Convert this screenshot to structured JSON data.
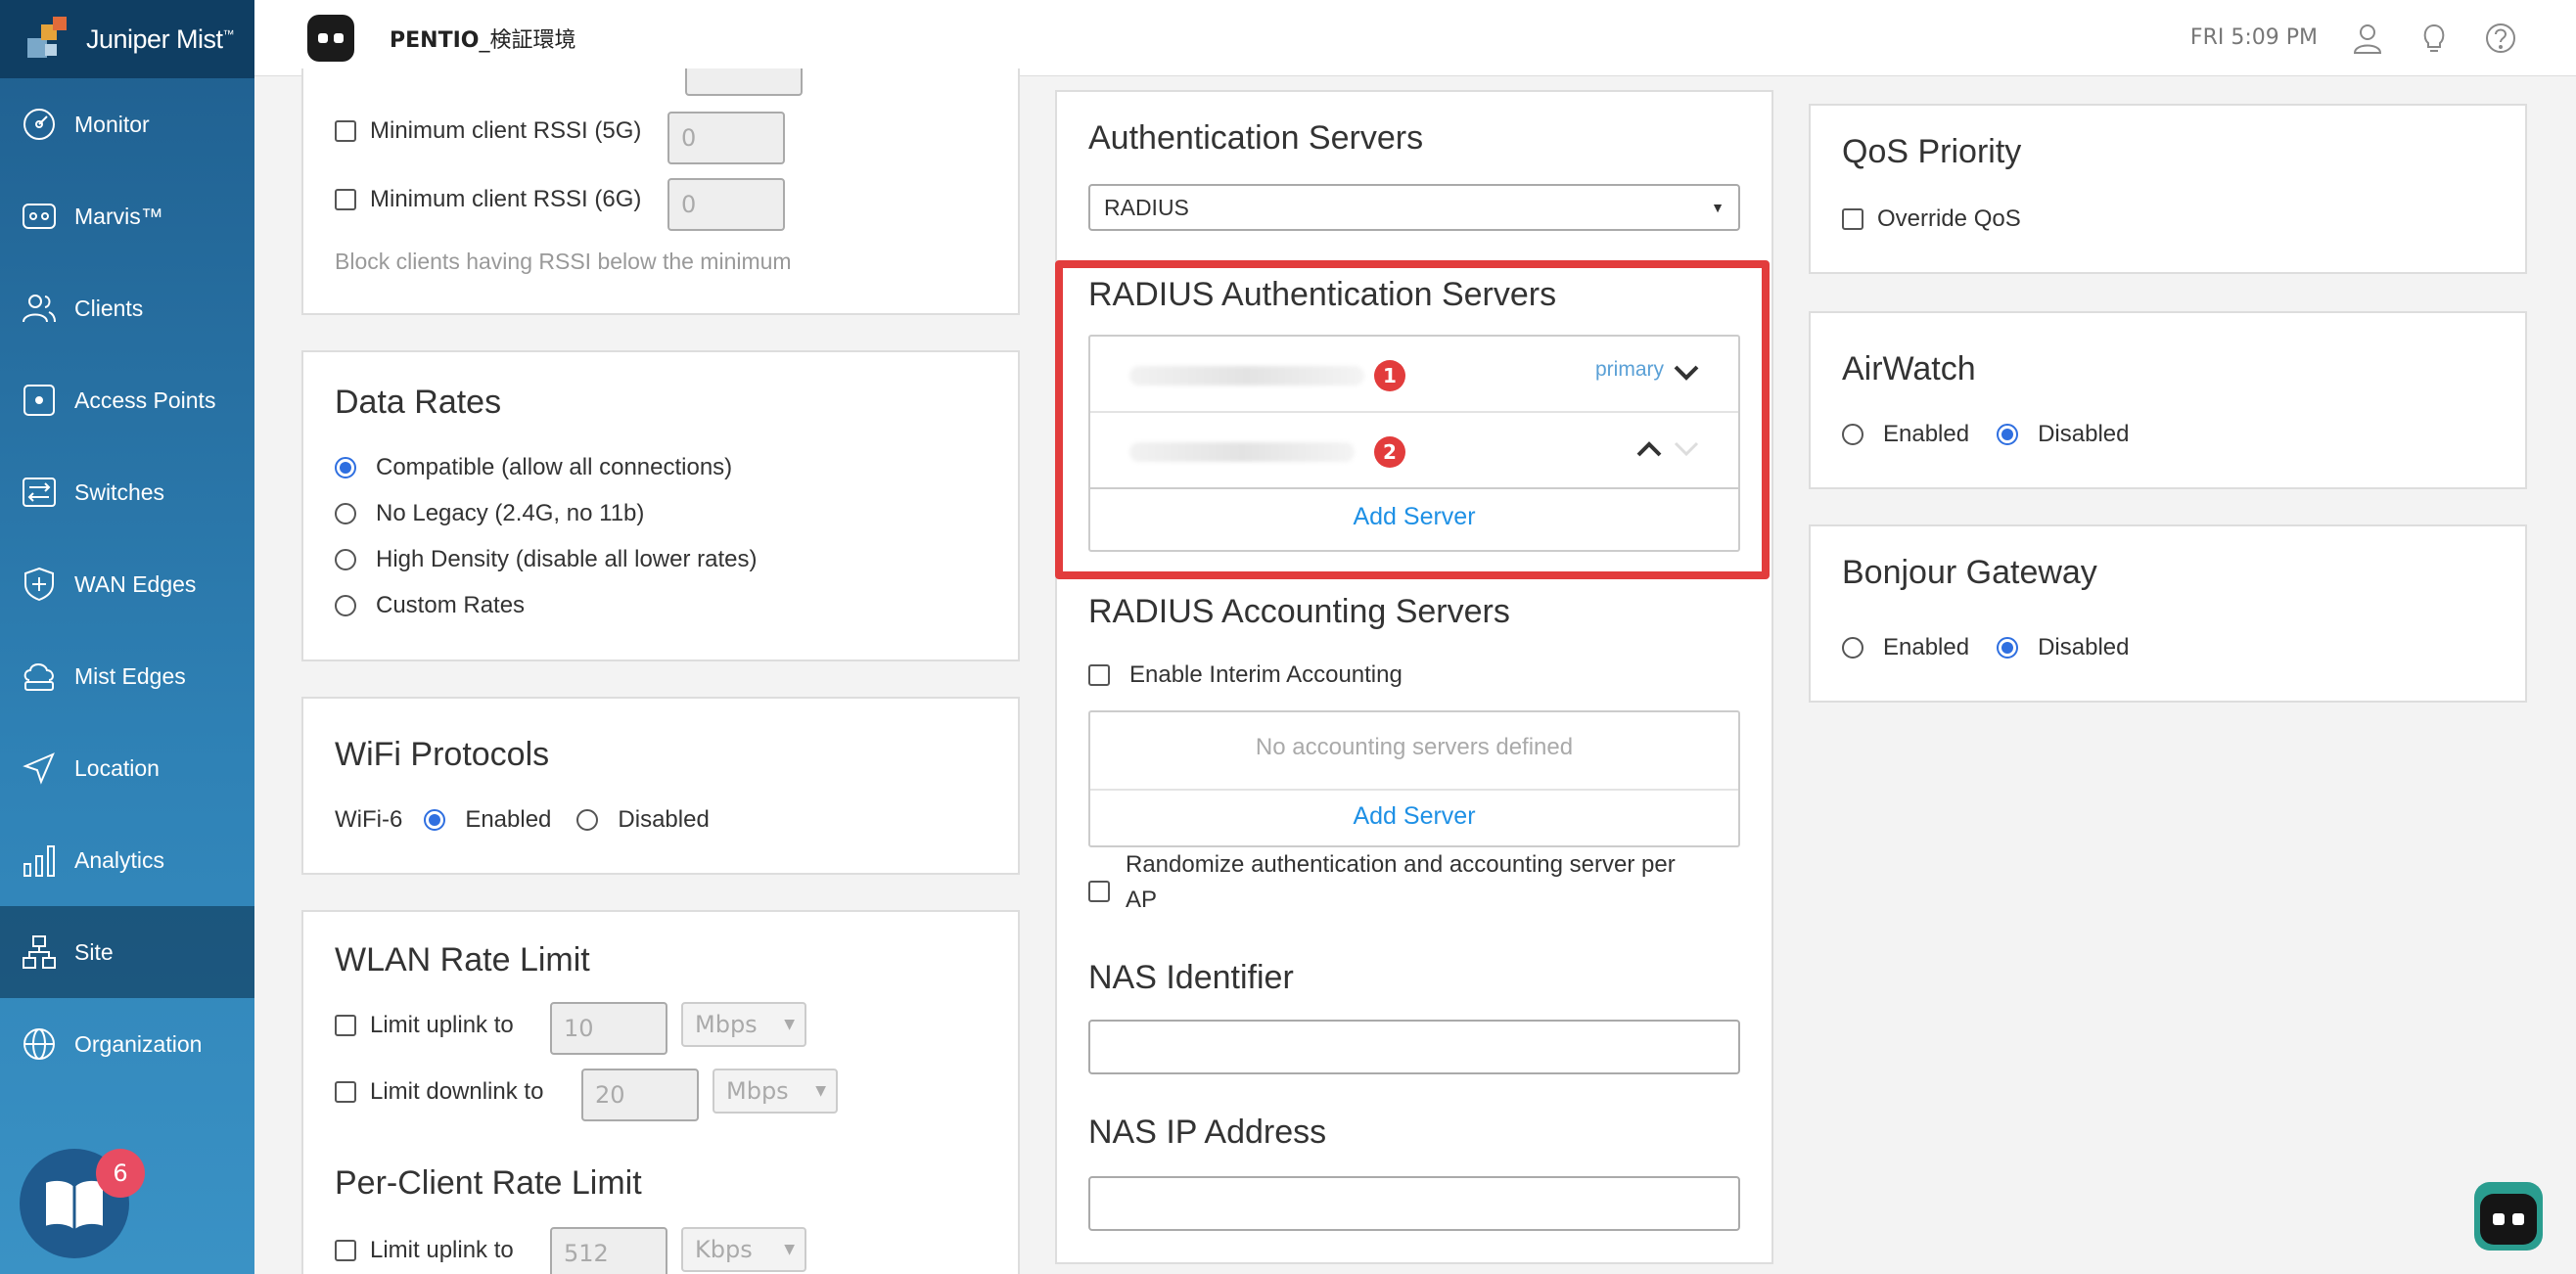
{
  "brand": {
    "name": "Juniper Mist",
    "tm": "™"
  },
  "header": {
    "site_name": "PENTIO",
    "site_suffix": "_検証環境",
    "time": "FRI 5:09 PM"
  },
  "sidebar": {
    "items": [
      {
        "label": "Monitor",
        "icon": "monitor-icon"
      },
      {
        "label": "Marvis™",
        "icon": "marvis-icon"
      },
      {
        "label": "Clients",
        "icon": "clients-icon"
      },
      {
        "label": "Access Points",
        "icon": "access-point-icon"
      },
      {
        "label": "Switches",
        "icon": "switch-icon"
      },
      {
        "label": "WAN Edges",
        "icon": "wan-edge-icon"
      },
      {
        "label": "Mist Edges",
        "icon": "mist-edge-icon"
      },
      {
        "label": "Location",
        "icon": "location-icon"
      },
      {
        "label": "Analytics",
        "icon": "analytics-icon"
      },
      {
        "label": "Site",
        "icon": "site-icon"
      },
      {
        "label": "Organization",
        "icon": "organization-icon"
      }
    ],
    "active": "Site",
    "help_badge": "6"
  },
  "rssi": {
    "min5g_label": "Minimum client RSSI (5G)",
    "min5g_value": "0",
    "min6g_label": "Minimum client RSSI (6G)",
    "min6g_value": "0",
    "hint": "Block clients having RSSI below the minimum"
  },
  "data_rates": {
    "title": "Data Rates",
    "options": [
      "Compatible (allow all connections)",
      "No Legacy (2.4G, no 11b)",
      "High Density (disable all lower rates)",
      "Custom Rates"
    ],
    "selected": 0
  },
  "wifi_protocols": {
    "title": "WiFi Protocols",
    "label": "WiFi-6",
    "enabled": "Enabled",
    "disabled": "Disabled"
  },
  "wlan_rate_limit": {
    "title": "WLAN Rate Limit",
    "uplink_label": "Limit uplink to",
    "uplink_value": "10",
    "uplink_unit": "Mbps",
    "downlink_label": "Limit downlink to",
    "downlink_value": "20",
    "downlink_unit": "Mbps"
  },
  "per_client_rate_limit": {
    "title": "Per-Client Rate Limit",
    "uplink_label": "Limit uplink to",
    "uplink_value": "512",
    "uplink_unit": "Kbps"
  },
  "auth_servers": {
    "title": "Authentication Servers",
    "type": "RADIUS",
    "radius_title": "RADIUS Authentication Servers",
    "servers": [
      {
        "badge": "1",
        "tag": "primary"
      },
      {
        "badge": "2",
        "tag": ""
      }
    ],
    "add_server": "Add Server"
  },
  "accounting": {
    "title": "RADIUS Accounting Servers",
    "interim_label": "Enable Interim Accounting",
    "empty": "No accounting servers defined",
    "add_server": "Add Server",
    "randomize_line1": "Randomize authentication and accounting server per",
    "randomize_line2": "AP"
  },
  "nas": {
    "identifier_title": "NAS Identifier",
    "ip_title": "NAS IP Address"
  },
  "qos": {
    "title": "QoS Priority",
    "override_label": "Override QoS"
  },
  "airwatch": {
    "title": "AirWatch",
    "enabled": "Enabled",
    "disabled": "Disabled"
  },
  "bonjour": {
    "title": "Bonjour Gateway",
    "enabled": "Enabled",
    "disabled": "Disabled"
  },
  "colors": {
    "accent": "#2f6fe0",
    "link": "#1e90e5",
    "highlight": "#e23c3c"
  }
}
